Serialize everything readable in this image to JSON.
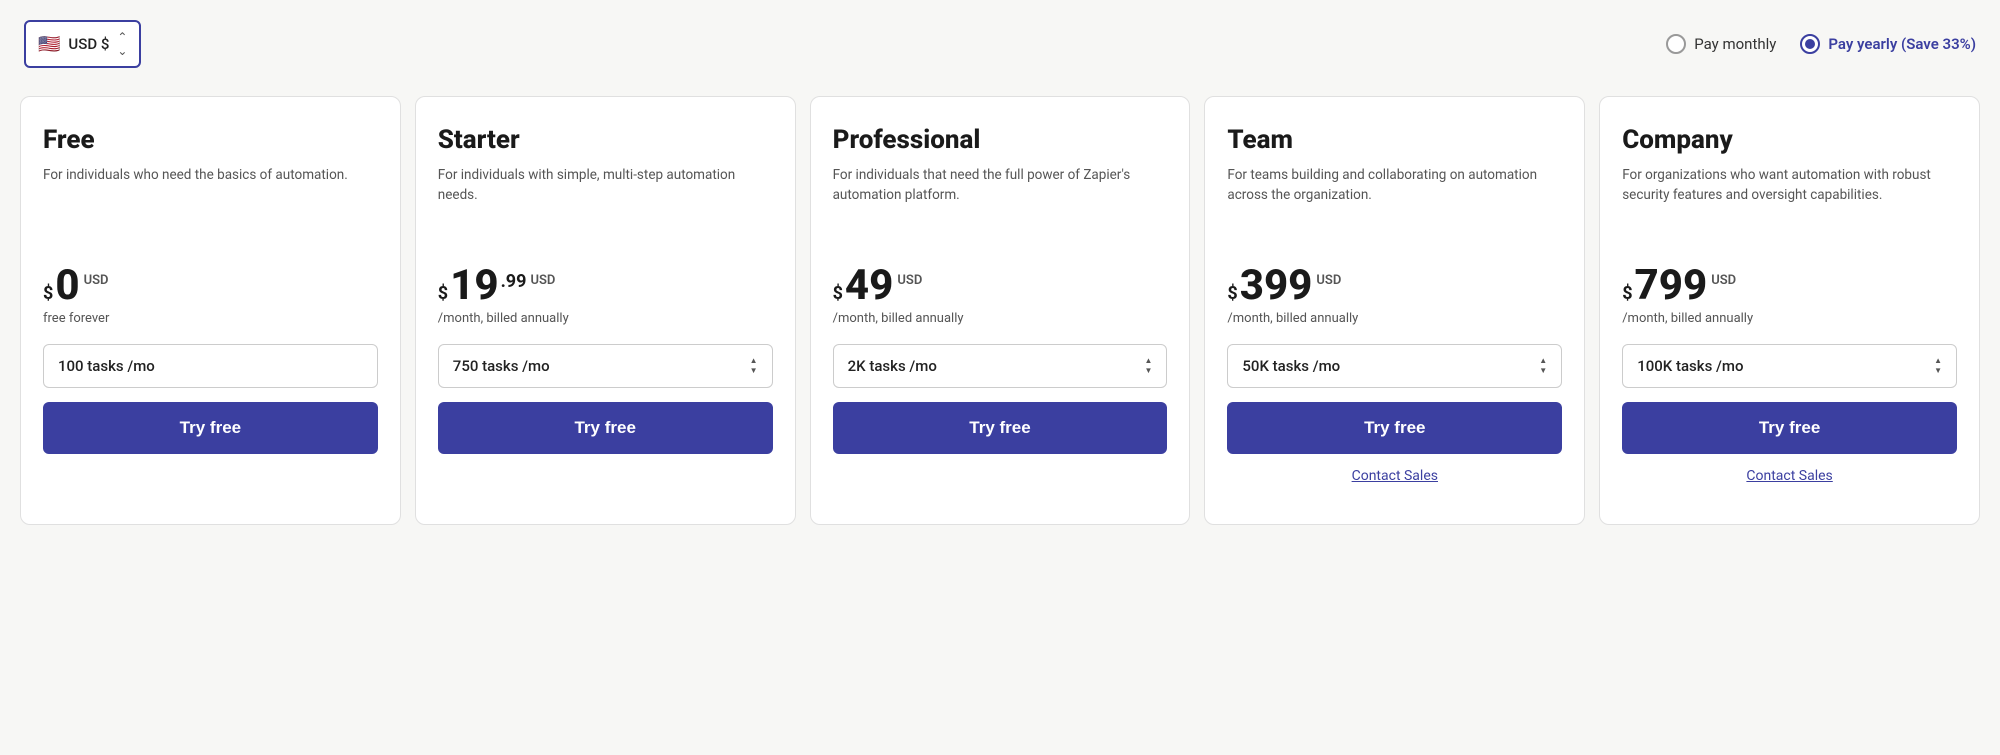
{
  "currency": {
    "label": "USD $",
    "flag": "🇺🇸"
  },
  "billing": {
    "monthly_label": "Pay monthly",
    "yearly_label": "Pay yearly (Save 33%)",
    "selected": "yearly"
  },
  "plans": [
    {
      "id": "free",
      "name": "Free",
      "description": "For individuals who need the basics of automation.",
      "price_symbol": "$",
      "price_main": "0",
      "price_cents": "",
      "price_usd": "USD",
      "price_period": "free forever",
      "tasks_label": "100 tasks /mo",
      "has_stepper": false,
      "cta_label": "Try free",
      "has_contact_sales": false
    },
    {
      "id": "starter",
      "name": "Starter",
      "description": "For individuals with simple, multi-step automation needs.",
      "price_symbol": "$",
      "price_main": "19",
      "price_cents": ".99",
      "price_usd": "USD",
      "price_period": "/month, billed annually",
      "tasks_label": "750 tasks /mo",
      "has_stepper": true,
      "cta_label": "Try free",
      "has_contact_sales": false
    },
    {
      "id": "professional",
      "name": "Professional",
      "description": "For individuals that need the full power of Zapier's automation platform.",
      "price_symbol": "$",
      "price_main": "49",
      "price_cents": "",
      "price_usd": "USD",
      "price_period": "/month, billed annually",
      "tasks_label": "2K tasks /mo",
      "has_stepper": true,
      "cta_label": "Try free",
      "has_contact_sales": false
    },
    {
      "id": "team",
      "name": "Team",
      "description": "For teams building and collaborating on automation across the organization.",
      "price_symbol": "$",
      "price_main": "399",
      "price_cents": "",
      "price_usd": "USD",
      "price_period": "/month, billed annually",
      "tasks_label": "50K tasks /mo",
      "has_stepper": true,
      "cta_label": "Try free",
      "has_contact_sales": true,
      "contact_sales_label": "Contact Sales"
    },
    {
      "id": "company",
      "name": "Company",
      "description": "For organizations who want automation with robust security features and oversight capabilities.",
      "price_symbol": "$",
      "price_main": "799",
      "price_cents": "",
      "price_usd": "USD",
      "price_period": "/month, billed annually",
      "tasks_label": "100K tasks /mo",
      "has_stepper": true,
      "cta_label": "Try free",
      "has_contact_sales": true,
      "contact_sales_label": "Contact Sales"
    }
  ]
}
